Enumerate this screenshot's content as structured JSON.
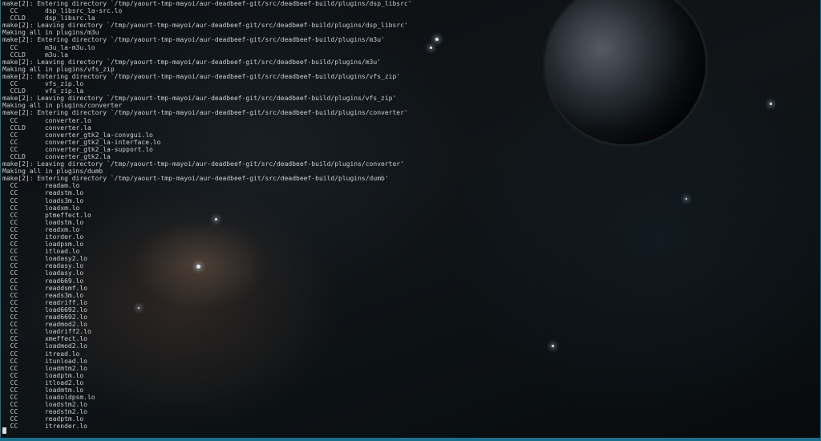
{
  "terminal": {
    "lines": [
      "make[2]: Entering directory `/tmp/yaourt-tmp-mayoi/aur-deadbeef-git/src/deadbeef-build/plugins/dsp_libsrc'",
      "  CC       dsp_libsrc_la-src.lo",
      "  CCLD     dsp_libsrc.la",
      "make[2]: Leaving directory `/tmp/yaourt-tmp-mayoi/aur-deadbeef-git/src/deadbeef-build/plugins/dsp_libsrc'",
      "Making all in plugins/m3u",
      "make[2]: Entering directory `/tmp/yaourt-tmp-mayoi/aur-deadbeef-git/src/deadbeef-build/plugins/m3u'",
      "  CC       m3u_la-m3u.lo",
      "  CCLD     m3u.la",
      "make[2]: Leaving directory `/tmp/yaourt-tmp-mayoi/aur-deadbeef-git/src/deadbeef-build/plugins/m3u'",
      "Making all in plugins/vfs_zip",
      "make[2]: Entering directory `/tmp/yaourt-tmp-mayoi/aur-deadbeef-git/src/deadbeef-build/plugins/vfs_zip'",
      "  CC       vfs_zip.lo",
      "  CCLD     vfs_zip.la",
      "make[2]: Leaving directory `/tmp/yaourt-tmp-mayoi/aur-deadbeef-git/src/deadbeef-build/plugins/vfs_zip'",
      "Making all in plugins/converter",
      "make[2]: Entering directory `/tmp/yaourt-tmp-mayoi/aur-deadbeef-git/src/deadbeef-build/plugins/converter'",
      "  CC       converter.lo",
      "  CCLD     converter.la",
      "  CC       converter_gtk2_la-convgui.lo",
      "  CC       converter_gtk2_la-interface.lo",
      "  CC       converter_gtk2_la-support.lo",
      "  CCLD     converter_gtk2.la",
      "make[2]: Leaving directory `/tmp/yaourt-tmp-mayoi/aur-deadbeef-git/src/deadbeef-build/plugins/converter'",
      "Making all in plugins/dumb",
      "make[2]: Entering directory `/tmp/yaourt-tmp-mayoi/aur-deadbeef-git/src/deadbeef-build/plugins/dumb'",
      "  CC       readam.lo",
      "  CC       readstm.lo",
      "  CC       loads3m.lo",
      "  CC       loadxm.lo",
      "  CC       ptmeffect.lo",
      "  CC       loadstm.lo",
      "  CC       readxm.lo",
      "  CC       itorder.lo",
      "  CC       loadpsm.lo",
      "  CC       itload.lo",
      "  CC       loadasy2.lo",
      "  CC       readasy.lo",
      "  CC       loadasy.lo",
      "  CC       read669.lo",
      "  CC       readdsmf.lo",
      "  CC       reads3m.lo",
      "  CC       readriff.lo",
      "  CC       load6692.lo",
      "  CC       read6692.lo",
      "  CC       readmod2.lo",
      "  CC       loadriff2.lo",
      "  CC       xmeffect.lo",
      "  CC       loadmod2.lo",
      "  CC       itread.lo",
      "  CC       itunload.lo",
      "  CC       loadmtm2.lo",
      "  CC       loadptm.lo",
      "  CC       itload2.lo",
      "  CC       loadmtm.lo",
      "  CC       loadoldpsm.lo",
      "  CC       loadstm2.lo",
      "  CC       readstm2.lo",
      "  CC       readptm.lo",
      "  CC       itrender.lo"
    ]
  },
  "colors": {
    "text": "#c9cdd1",
    "border_accent": "#1a6f8a",
    "background": "#0b0f12"
  }
}
